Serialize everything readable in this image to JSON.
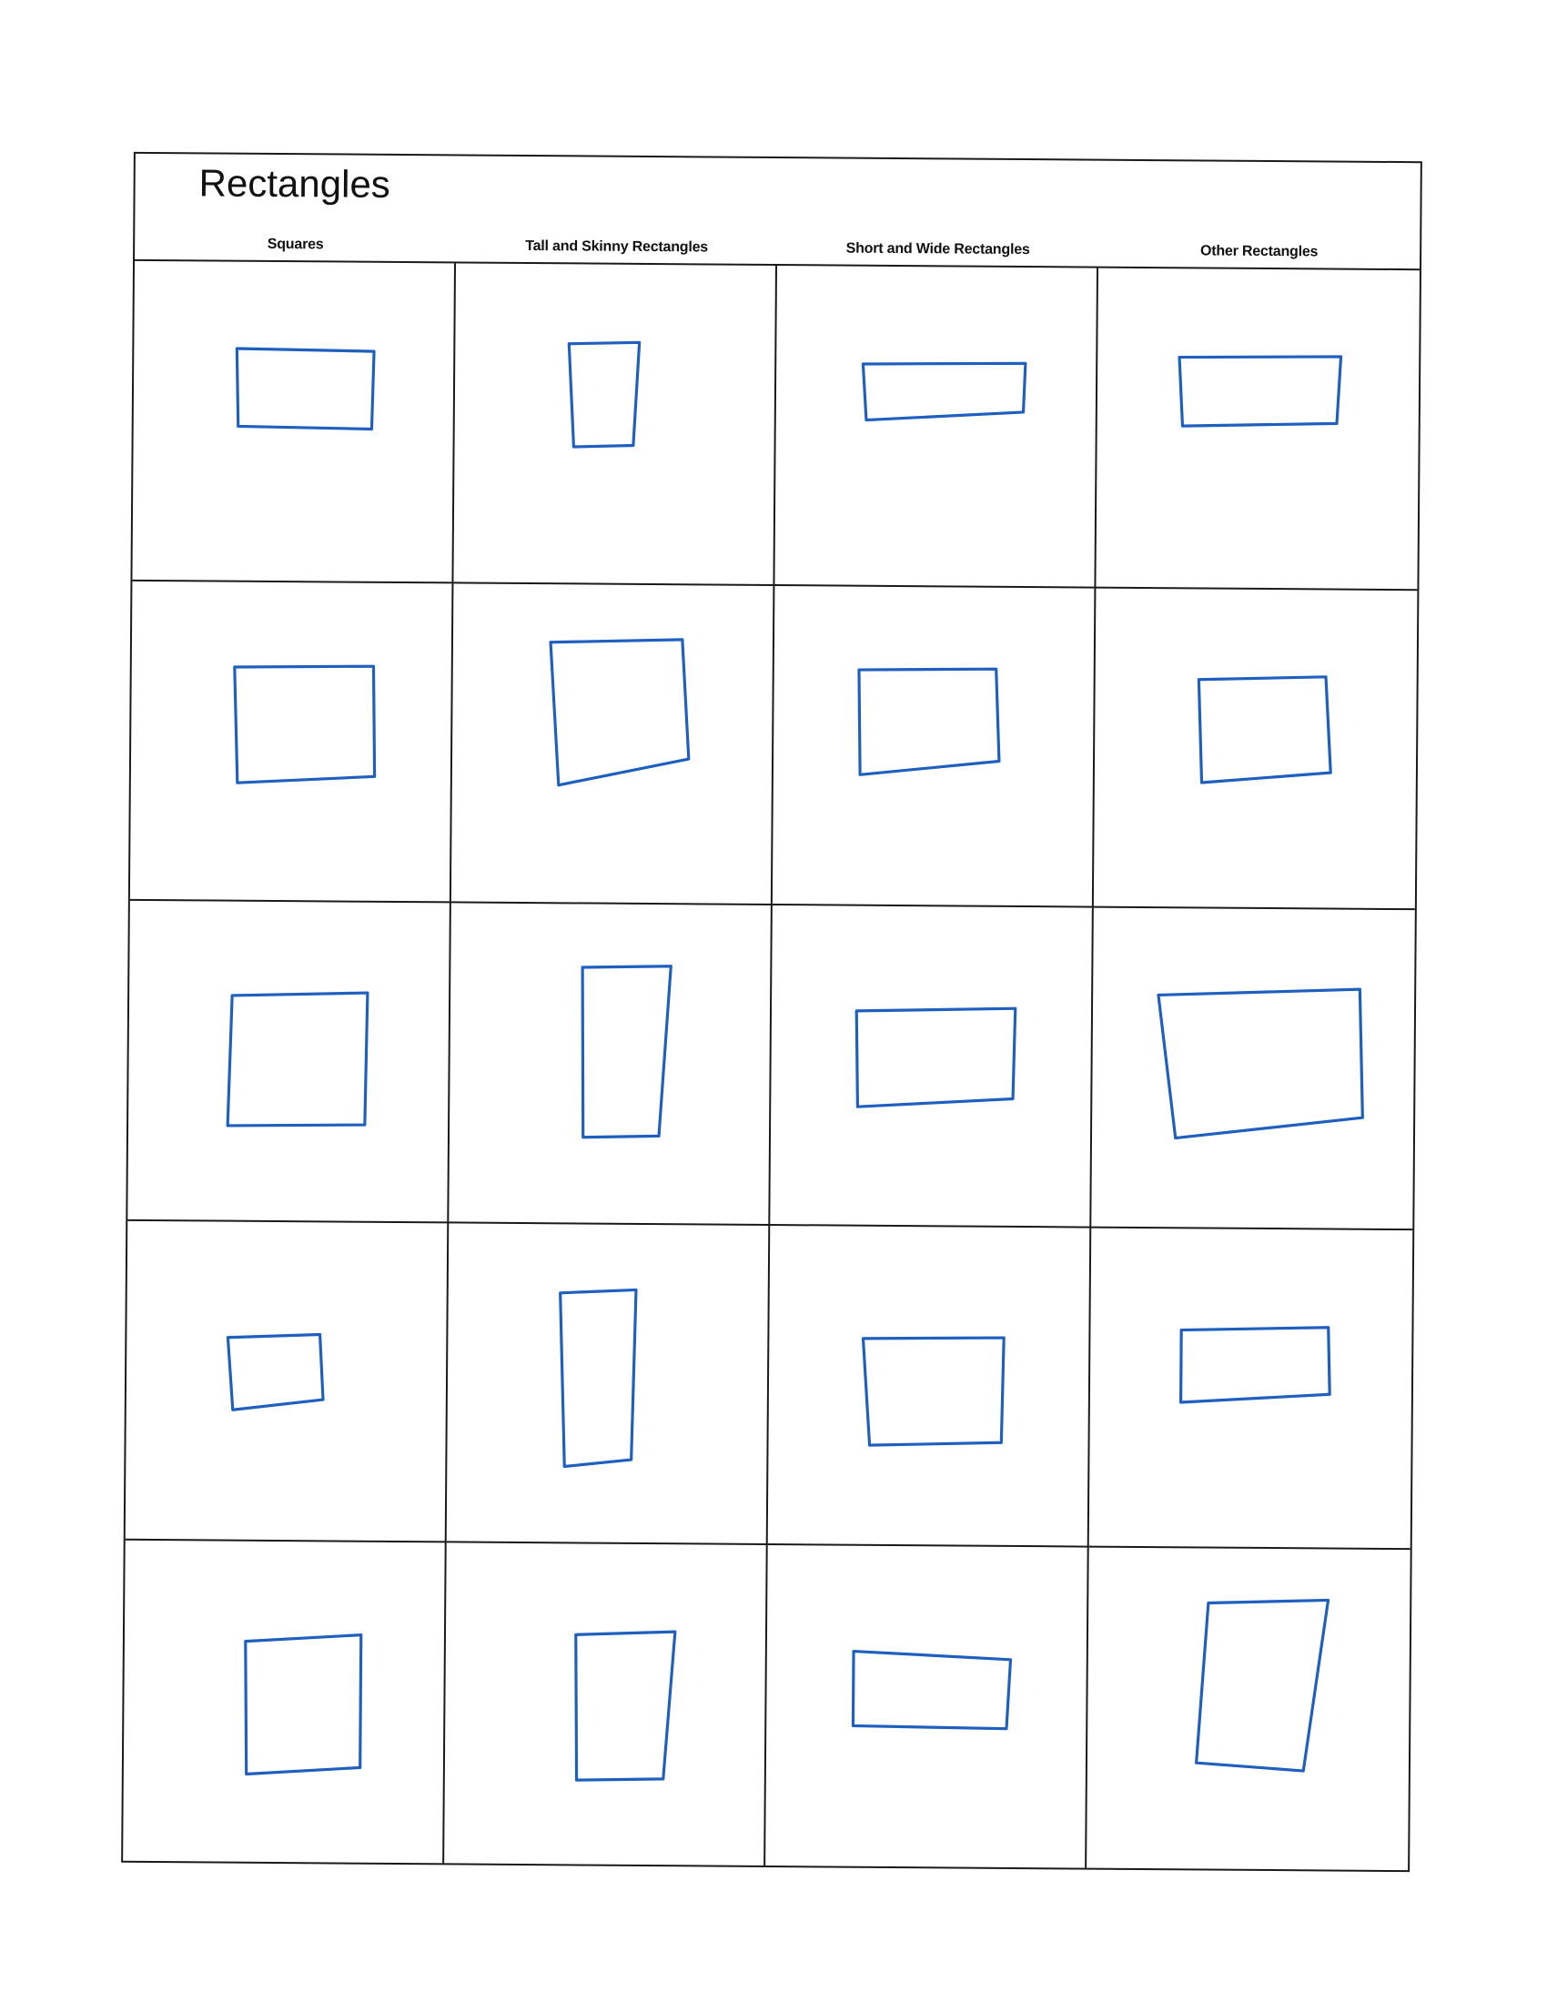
{
  "worksheet": {
    "title": "Rectangles",
    "columns": [
      "Squares",
      "Tall and Skinny Rectangles",
      "Short and Wide Rectangles",
      "Other Rectangles"
    ],
    "rows": 5,
    "ink_color": "#1f5fbf",
    "line_color": "#1a1a1a"
  }
}
